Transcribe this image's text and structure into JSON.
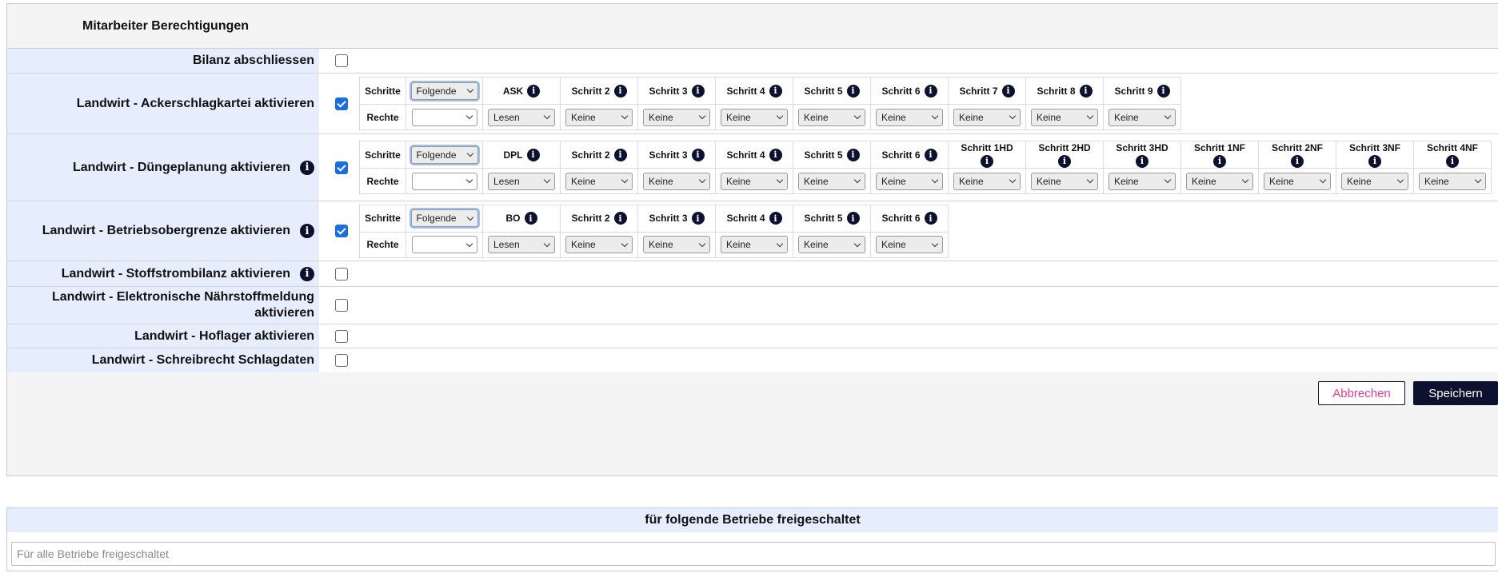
{
  "panel": {
    "title": "Mitarbeiter Berechtigungen",
    "rows": {
      "bilanz": {
        "label": "Bilanz abschliessen",
        "checked": false
      },
      "ackerschlag": {
        "label": "Landwirt - Ackerschlagkartei aktivieren",
        "checked": true
      },
      "duenge": {
        "label": "Landwirt - Düngeplanung aktivieren",
        "checked": true
      },
      "betrieb": {
        "label": "Landwirt - Betriebsobergrenze aktivieren",
        "checked": true
      },
      "stoff": {
        "label": "Landwirt - Stoffstrombilanz aktivieren",
        "checked": false
      },
      "elektro": {
        "label": "Landwirt - Elektronische Nährstoffmeldung aktivieren",
        "checked": false
      },
      "hoflager": {
        "label": "Landwirt - Hoflager aktivieren",
        "checked": false
      },
      "schreib": {
        "label": "Landwirt - Schreibrecht Schlagdaten",
        "checked": false
      }
    },
    "grid_labels": {
      "schritte": "Schritte",
      "rechte": "Rechte",
      "folgende": "Folgende"
    },
    "ask_grid": {
      "steps": [
        "ASK",
        "Schritt 2",
        "Schritt 3",
        "Schritt 4",
        "Schritt 5",
        "Schritt 6",
        "Schritt 7",
        "Schritt 8",
        "Schritt 9"
      ],
      "rights": [
        "Lesen",
        "Keine",
        "Keine",
        "Keine",
        "Keine",
        "Keine",
        "Keine",
        "Keine",
        "Keine"
      ]
    },
    "dpl_grid": {
      "steps": [
        "DPL",
        "Schritt 2",
        "Schritt 3",
        "Schritt 4",
        "Schritt 5",
        "Schritt 6",
        "Schritt 1HD",
        "Schritt 2HD",
        "Schritt 3HD",
        "Schritt 1NF",
        "Schritt 2NF",
        "Schritt 3NF",
        "Schritt 4NF"
      ],
      "rights": [
        "Lesen",
        "Keine",
        "Keine",
        "Keine",
        "Keine",
        "Keine",
        "Keine",
        "Keine",
        "Keine",
        "Keine",
        "Keine",
        "Keine",
        "Keine"
      ]
    },
    "bo_grid": {
      "steps": [
        "BO",
        "Schritt 2",
        "Schritt 3",
        "Schritt 4",
        "Schritt 5",
        "Schritt 6"
      ],
      "rights": [
        "Lesen",
        "Keine",
        "Keine",
        "Keine",
        "Keine",
        "Keine"
      ]
    },
    "buttons": {
      "cancel": "Abbrechen",
      "save": "Speichern"
    }
  },
  "betriebe": {
    "title": "für folgende Betriebe freigeschaltet",
    "placeholder": "Für alle Betriebe freigeschaltet"
  },
  "colors": {
    "label_bg": "#e6edfd",
    "accent_dark": "#0d1130",
    "cancel_text": "#e23c8c",
    "checkbox": "#1a6fe0"
  },
  "icons": {
    "info": "info-icon",
    "dropdown": "chevron-down-icon",
    "checkbox": "checkbox-icon"
  }
}
